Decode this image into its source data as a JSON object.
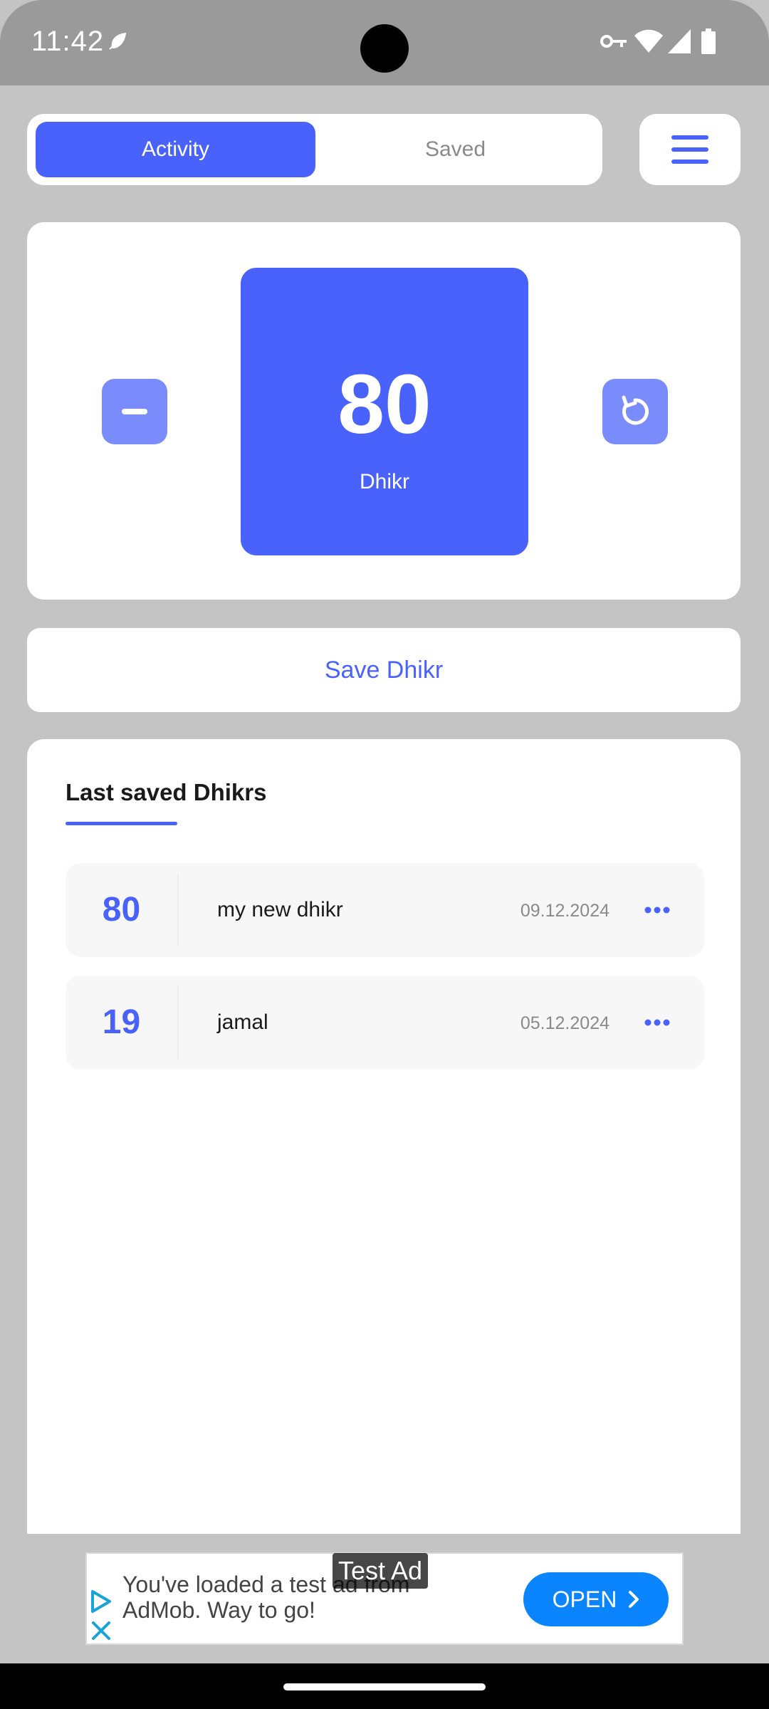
{
  "status_bar": {
    "time": "11:42"
  },
  "tabs": {
    "activity_label": "Activity",
    "saved_label": "Saved"
  },
  "counter": {
    "value": "80",
    "label": "Dhikr"
  },
  "save_button": {
    "label": "Save Dhikr"
  },
  "last_saved": {
    "title": "Last saved Dhikrs",
    "items": [
      {
        "count": "80",
        "name": "my new dhikr",
        "date": "09.12.2024"
      },
      {
        "count": "19",
        "name": "jamal",
        "date": "05.12.2024"
      }
    ]
  },
  "ad": {
    "badge": "Test Ad",
    "line1": "You've loaded a test ad from",
    "line2": "AdMob. Way to go!",
    "open_label": "OPEN"
  },
  "colors": {
    "accent": "#4862fb",
    "accent_light": "#7a8cfb",
    "background": "#c4c4c4",
    "ad_button": "#0a84ff"
  },
  "icons": [
    "leaf-icon",
    "key-icon",
    "wifi-icon",
    "signal-icon",
    "battery-icon",
    "hamburger-menu-icon",
    "minus-icon",
    "reset-icon",
    "more-dots-icon",
    "ad-play-icon",
    "ad-close-icon",
    "chevron-right-icon"
  ]
}
